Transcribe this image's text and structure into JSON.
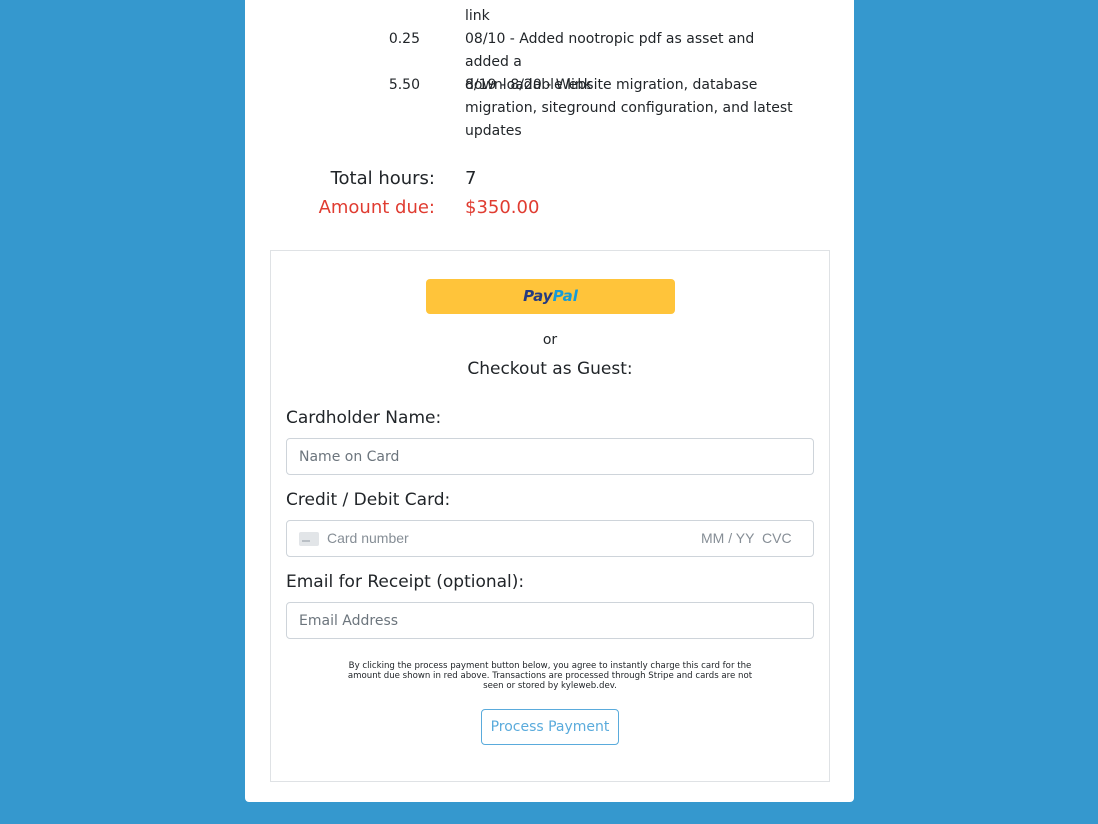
{
  "invoice": {
    "line_items": [
      {
        "hours": "",
        "description": "link"
      },
      {
        "hours": "0.25",
        "description_lines": [
          "08/10 - Added nootropic pdf as asset and added a",
          "downloadable link"
        ]
      },
      {
        "hours": "5.50",
        "description_lines": [
          "8/19 - 8/20 - Website migration, database",
          "migration, siteground configuration, and latest",
          "updates"
        ]
      }
    ],
    "total_hours_label": "Total hours:",
    "total_hours_value": "7",
    "amount_due_label": "Amount due:",
    "amount_due_value": "$350.00"
  },
  "payment": {
    "paypal_label_part1": "Pay",
    "paypal_label_part2": "Pal",
    "or_text": "or",
    "guest_title": "Checkout as Guest:",
    "cardholder_label": "Cardholder Name:",
    "cardholder_placeholder": "Name on Card",
    "card_label": "Credit / Debit Card:",
    "card_number_placeholder": "Card number",
    "card_exp_placeholder": "MM / YY",
    "card_cvc_placeholder": "CVC",
    "email_label": "Email for Receipt (optional):",
    "email_placeholder": "Email Address",
    "disclaimer_lines": [
      "By clicking the process payment button below, you agree to instantly charge this card for the",
      "amount due shown in red above. Transactions are processed through Stripe and cards are not",
      "seen or stored by kyleweb.dev."
    ],
    "process_button_label": "Process Payment"
  },
  "colors": {
    "page_background": "#3598ce",
    "amount_due_red": "#e03c31",
    "paypal_yellow": "#ffc43a",
    "process_button_blue": "#5aabdc"
  }
}
